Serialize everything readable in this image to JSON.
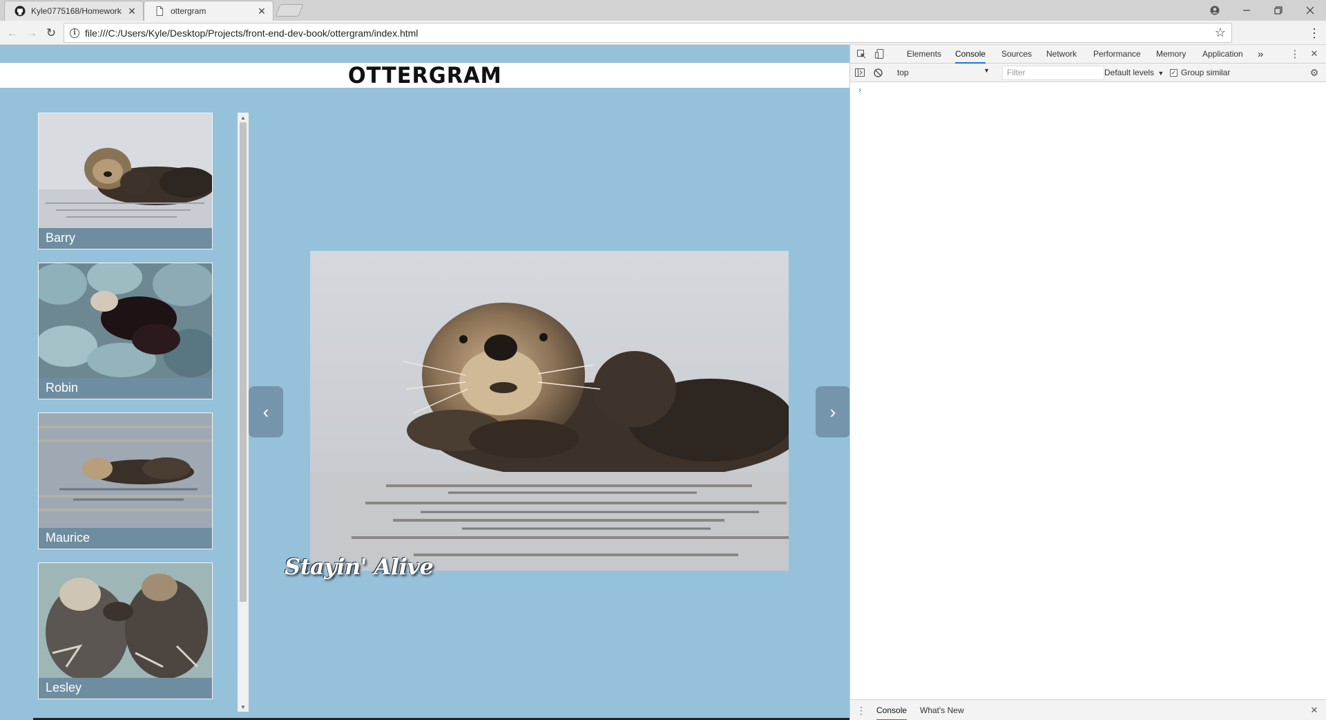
{
  "browser": {
    "tabs": [
      {
        "title": "Kyle0775168/Homework",
        "favicon": "github-icon",
        "active": false
      },
      {
        "title": "ottergram",
        "favicon": "page-icon",
        "active": true
      }
    ],
    "url": "file:///C:/Users/Kyle/Desktop/Projects/front-end-dev-book/ottergram/index.html",
    "window_controls": [
      "account-icon",
      "minimize-icon",
      "restore-icon",
      "close-icon"
    ]
  },
  "page": {
    "logo": "OTTERGRAM",
    "thumbnails": [
      {
        "label": "Barry",
        "image": "otter-floating-with-pup"
      },
      {
        "label": "Robin",
        "image": "otter-on-rocks"
      },
      {
        "label": "Maurice",
        "image": "otter-floating-in-water"
      },
      {
        "label": "Lesley",
        "image": "two-otters-holding-paws"
      }
    ],
    "prev_label": "‹",
    "next_label": "›",
    "detail_title": "Stayin' Alive",
    "detail_image": "otter-floating-with-pup",
    "background_color": "#96c1da",
    "thumbnail_label_color": "#6e8da0"
  },
  "devtools": {
    "tabs": [
      "Elements",
      "Console",
      "Sources",
      "Network",
      "Performance",
      "Memory",
      "Application"
    ],
    "active_tab": "Console",
    "more_tabs": "»",
    "context": "top",
    "filter_placeholder": "Filter",
    "levels": "Default levels",
    "group_similar": "Group similar",
    "group_similar_checked": true,
    "prompt": "›",
    "drawer_tabs": [
      "Console",
      "What's New"
    ],
    "active_drawer_tab": "Console",
    "accent_color": "#1a73e8"
  }
}
